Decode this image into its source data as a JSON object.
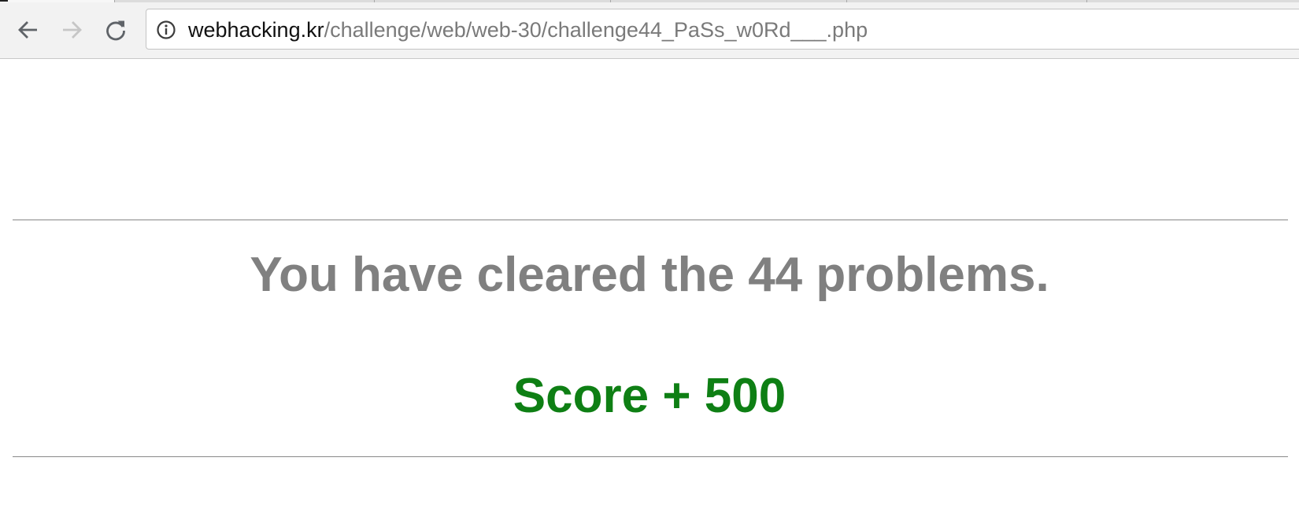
{
  "browser": {
    "nav": {
      "back_icon": "arrow-left-icon",
      "forward_icon": "arrow-right-icon",
      "reload_icon": "reload-icon"
    },
    "address_bar": {
      "info_icon": "info-icon",
      "host": "webhacking.kr",
      "path": "/challenge/web/web-30/challenge44_PaSs_w0Rd___.php"
    }
  },
  "page": {
    "message": "You have cleared the 44 problems.",
    "score": "Score + 500"
  },
  "colors": {
    "message": "#808080",
    "score": "#0e7f14",
    "url_host": "#111111",
    "url_path": "#7a7a7a"
  }
}
